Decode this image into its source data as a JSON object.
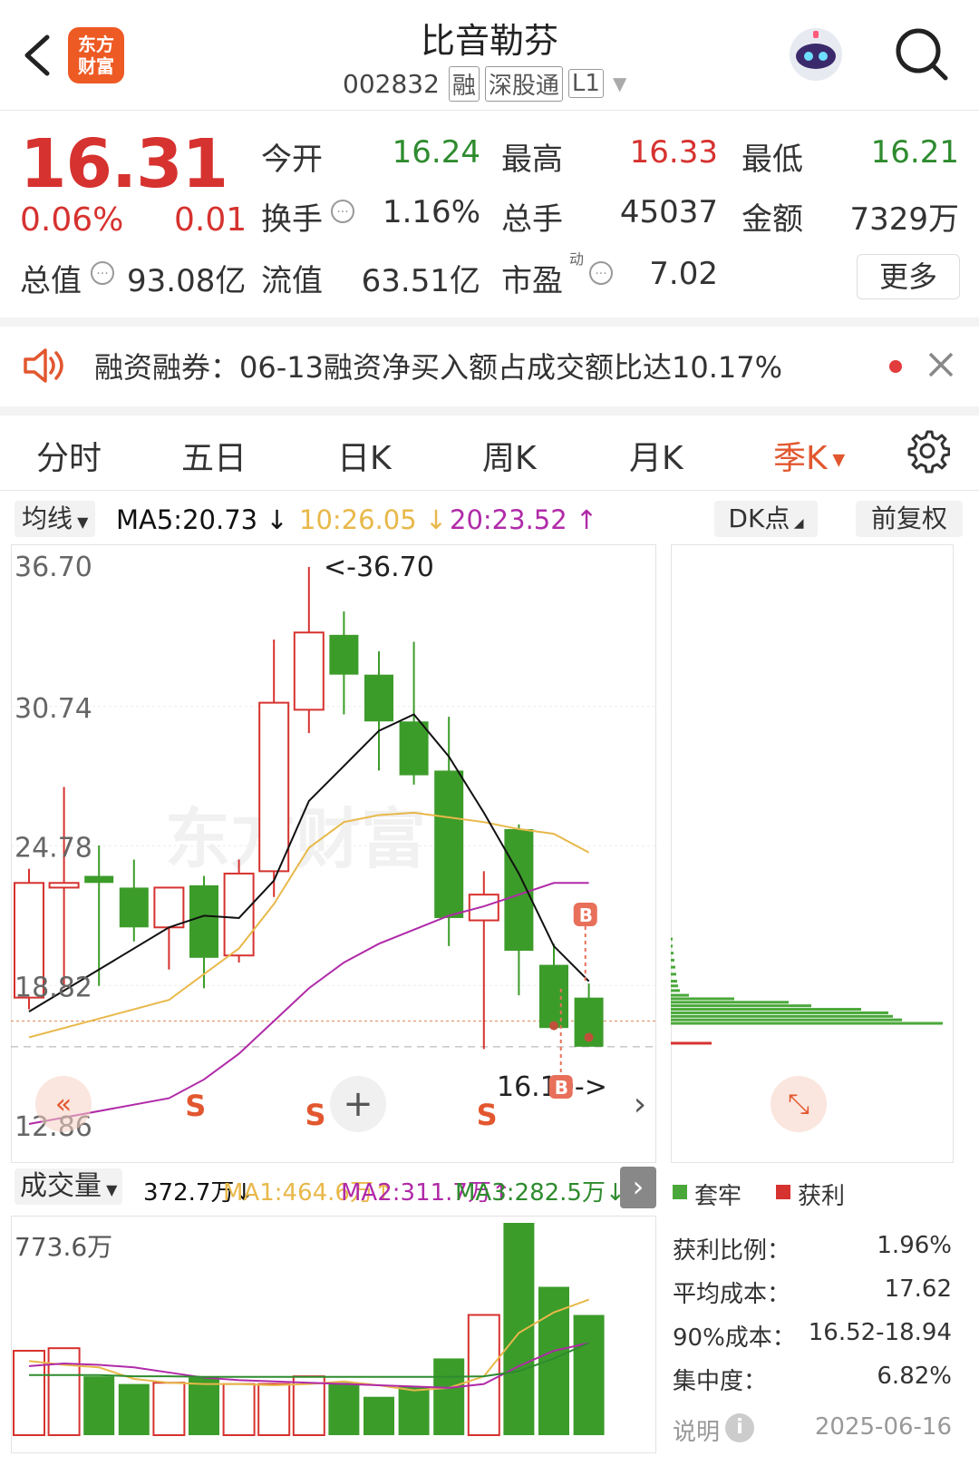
{
  "header": {
    "logo_line1": "东方",
    "logo_line2": "财富",
    "stock_name": "比音勒芬",
    "stock_code": "002832",
    "tags": [
      "融",
      "深股通",
      "L1"
    ]
  },
  "quote": {
    "price": "16.31",
    "change_pct": "0.06%",
    "change": "0.01",
    "fields": [
      {
        "label": "今开",
        "value": "16.24",
        "color": "green"
      },
      {
        "label": "最高",
        "value": "16.33",
        "color": "red"
      },
      {
        "label": "最低",
        "value": "16.21",
        "color": "green"
      },
      {
        "label": "换手",
        "value": "1.16%",
        "color": "dark"
      },
      {
        "label": "总手",
        "value": "45037",
        "color": "dark"
      },
      {
        "label": "金额",
        "value": "7329万",
        "color": "dark"
      }
    ],
    "total_value_label": "总值",
    "total_value": "93.08亿",
    "float_value_label": "流值",
    "float_value": "63.51亿",
    "pe_label": "市盈",
    "pe_sup": "动",
    "pe_value": "7.02",
    "more_label": "更多"
  },
  "notice": {
    "text": "融资融券：06-13融资净买入额占成交额比达10.17%"
  },
  "tabs": [
    "分时",
    "五日",
    "日K",
    "周K",
    "月K",
    "季K"
  ],
  "active_tab": "季K",
  "ma_bar": {
    "selector": "均线",
    "ma5": "MA5:20.73 ↓",
    "ma10": "10:26.05 ↓",
    "ma20": "20:23.52 ↑",
    "dk_label": "DK点",
    "fq_label": "前复权"
  },
  "colors": {
    "up": "#d6322f",
    "down": "#3c9c2a",
    "ma5": "#111111",
    "ma10": "#e8b84a",
    "ma20": "#b02aa8",
    "accent": "#e2572f"
  },
  "chart_data": [
    {
      "type": "candlestick",
      "title": "季K",
      "y_ticks": [
        "36.70",
        "30.74",
        "24.78",
        "18.82",
        "12.86"
      ],
      "ylim": [
        12.86,
        36.7
      ],
      "annotations": [
        "<-36.70",
        "16.10->"
      ],
      "candles": [
        {
          "o": 18.3,
          "h": 23.8,
          "l": 17.8,
          "c": 23.2
        },
        {
          "o": 23.0,
          "h": 27.3,
          "l": 18.7,
          "c": 23.2
        },
        {
          "o": 23.5,
          "h": 24.8,
          "l": 18.8,
          "c": 23.2
        },
        {
          "o": 23.0,
          "h": 24.2,
          "l": 20.7,
          "c": 21.3
        },
        {
          "o": 21.3,
          "h": 22.8,
          "l": 19.5,
          "c": 23.0
        },
        {
          "o": 23.1,
          "h": 23.5,
          "l": 18.7,
          "c": 20.0
        },
        {
          "o": 20.1,
          "h": 24.2,
          "l": 19.8,
          "c": 23.6
        },
        {
          "o": 23.7,
          "h": 33.6,
          "l": 22.6,
          "c": 30.9
        },
        {
          "o": 30.6,
          "h": 36.7,
          "l": 29.6,
          "c": 33.9
        },
        {
          "o": 33.8,
          "h": 34.8,
          "l": 30.4,
          "c": 32.1
        },
        {
          "o": 32.1,
          "h": 33.1,
          "l": 28.0,
          "c": 30.1
        },
        {
          "o": 30.1,
          "h": 33.5,
          "l": 27.4,
          "c": 27.8
        },
        {
          "o": 28.0,
          "h": 30.3,
          "l": 20.5,
          "c": 21.7
        },
        {
          "o": 21.6,
          "h": 23.7,
          "l": 16.1,
          "c": 22.7
        },
        {
          "o": 25.5,
          "h": 25.7,
          "l": 18.4,
          "c": 20.3
        },
        {
          "o": 19.7,
          "h": 20.6,
          "l": 17.6,
          "c": 17.0
        },
        {
          "o": 18.3,
          "h": 18.9,
          "l": 16.7,
          "c": 16.2
        }
      ],
      "ma5": [
        17.7,
        null,
        null,
        null,
        21.3,
        21.8,
        21.7,
        23.3,
        26.7,
        28.2,
        29.7,
        30.4,
        28.6,
        26.2,
        23.6,
        20.5,
        19.0
      ],
      "ma10": [
        16.6,
        null,
        null,
        null,
        18.2,
        19.3,
        20.4,
        22.3,
        24.7,
        25.8,
        26.1,
        26.2,
        26.0,
        25.8,
        25.5,
        25.3,
        24.5
      ],
      "ma20": [
        12.9,
        null,
        null,
        null,
        14.0,
        14.8,
        15.9,
        17.3,
        18.7,
        19.8,
        20.6,
        21.2,
        21.8,
        22.2,
        22.7,
        23.2,
        23.2
      ],
      "markers": [
        "S",
        "S",
        "S",
        "S",
        "B",
        "B"
      ]
    },
    {
      "type": "bar",
      "title": "成交量",
      "y_top_label": "773.6万",
      "legend": [
        "372.7万↓",
        "MA1:464.6万↑",
        "MA2:311.7万↑",
        "MA3:282.5万↓"
      ],
      "values": [
        330,
        340,
        230,
        200,
        205,
        225,
        200,
        200,
        230,
        205,
        150,
        190,
        300,
        470,
        830,
        580,
        470
      ],
      "up_flags": [
        true,
        true,
        false,
        false,
        true,
        false,
        true,
        true,
        true,
        false,
        false,
        false,
        false,
        true,
        false,
        false,
        false
      ]
    },
    {
      "type": "bar",
      "title": "筹码分布",
      "legend": [
        "套牢",
        "获利"
      ]
    }
  ],
  "chips_info": {
    "rows": [
      {
        "label": "获利比例：",
        "value": "1.96%"
      },
      {
        "label": "平均成本：",
        "value": "17.62"
      },
      {
        "label": "90%成本：",
        "value": "16.52-18.94"
      },
      {
        "label": "集中度：",
        "value": "6.82%"
      }
    ],
    "explain_label": "说明",
    "date": "2025-06-16"
  }
}
